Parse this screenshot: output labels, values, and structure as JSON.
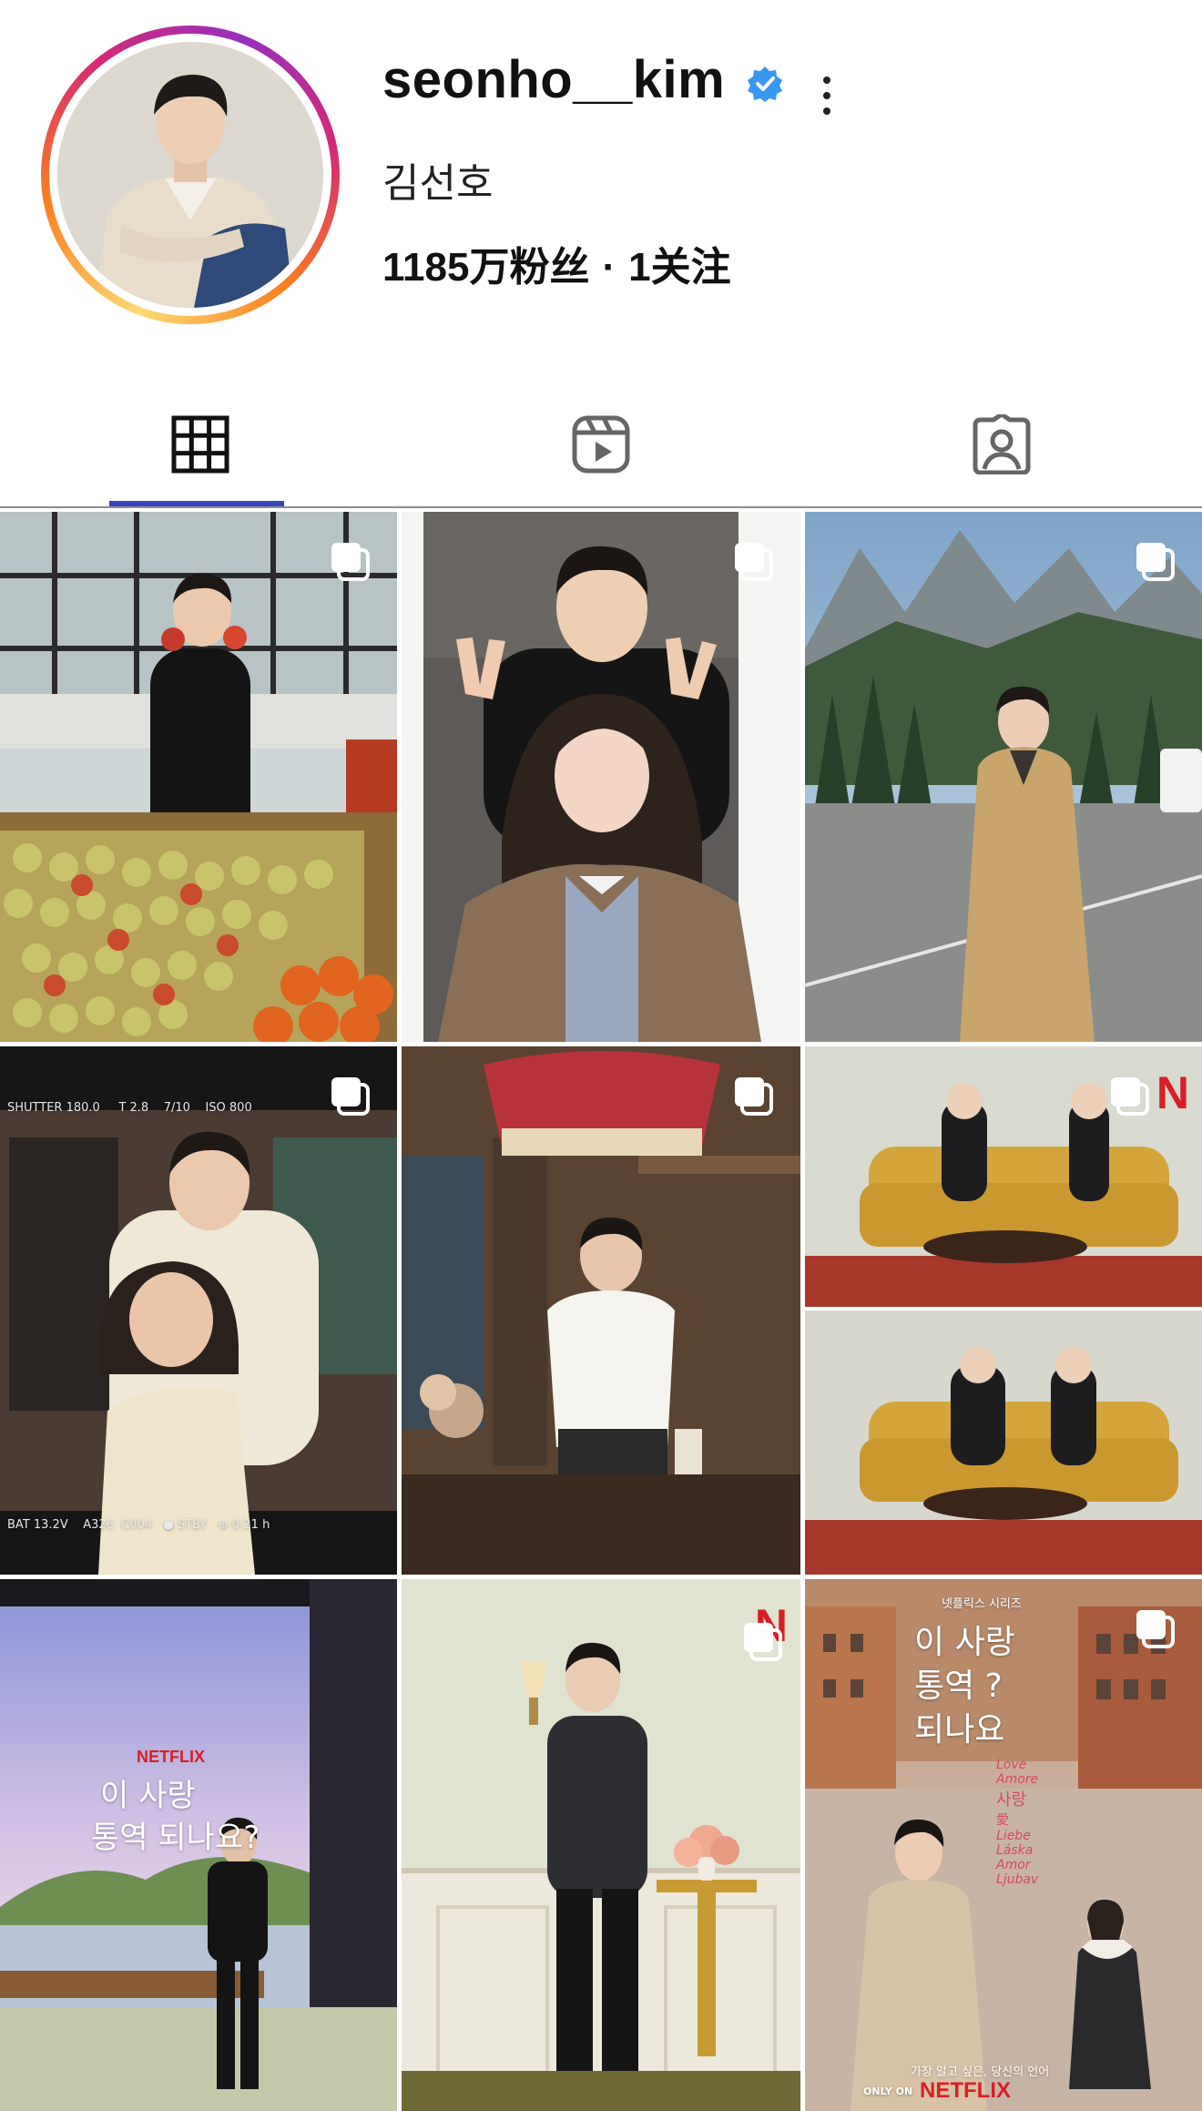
{
  "profile": {
    "username": "seonho__kim",
    "display_name": "김선호",
    "followers": "1185万粉丝",
    "separator": "·",
    "following": "1关注",
    "verified": true
  },
  "tabs": [
    {
      "name": "posts",
      "icon": "grid-icon",
      "active": true
    },
    {
      "name": "reels",
      "icon": "reels-icon",
      "active": false
    },
    {
      "name": "tagged",
      "icon": "tagged-icon",
      "active": false
    }
  ],
  "posts": [
    {
      "id": 1,
      "scene": "grocery-store-apples",
      "multi": true
    },
    {
      "id": 2,
      "scene": "couple-peace-signs",
      "multi": true
    },
    {
      "id": 3,
      "scene": "mountain-road-coat",
      "multi": true
    },
    {
      "id": 4,
      "scene": "monitor-behind-scenes",
      "multi": true,
      "monitor_top": "SHUTTER 180.0     T 2.8    7/10    ISO 800",
      "monitor_bottom": "BAT 13.2V    A326  C004   ● STBY   ⊕ 0:21 h"
    },
    {
      "id": 5,
      "scene": "kitchen-white-shirt",
      "multi": true
    },
    {
      "id": 6,
      "scene": "yellow-sofa-poster",
      "multi": true,
      "netflix_badge": "N"
    },
    {
      "id": 7,
      "scene": "stage-premiere",
      "multi": false,
      "brand": "NETFLIX",
      "poster_title_1": "이 사랑",
      "poster_title_2": "통역 되나요?"
    },
    {
      "id": 8,
      "scene": "green-wall-portrait",
      "multi": true,
      "netflix_badge": "N"
    },
    {
      "id": 9,
      "scene": "city-poster",
      "multi": true,
      "poster_kicker": "넷플릭스 시리즈",
      "poster_line1": "이 사랑",
      "poster_line2": "통역 ?",
      "poster_line3": "되나요",
      "poster_words": [
        "Love",
        "Amore",
        "사랑",
        "愛",
        "Liebe",
        "Láska",
        "Amor",
        "Ljubav"
      ],
      "poster_tagline": "가장 알고 싶은, 당신의 언어",
      "poster_only": "ONLY ON",
      "poster_brand": "NETFLIX"
    }
  ],
  "colors": {
    "accent_tab": "#3944bc",
    "verified_blue": "#3897f0",
    "netflix_red": "#d81f26"
  }
}
